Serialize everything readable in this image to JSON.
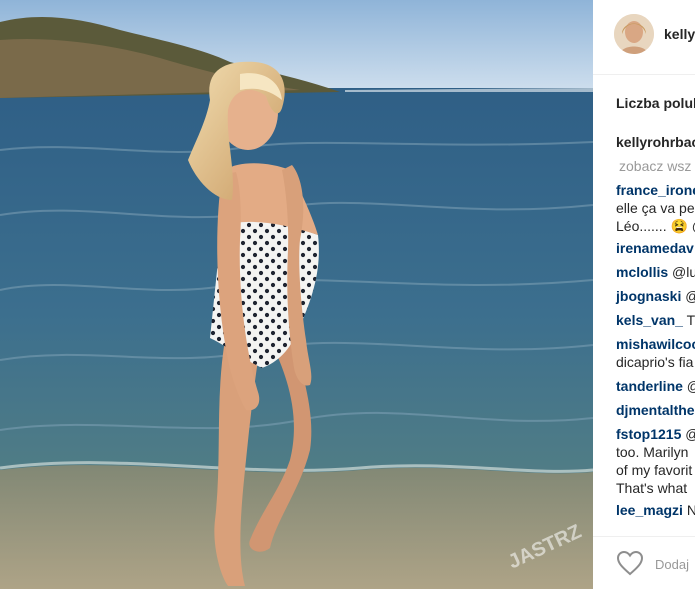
{
  "post": {
    "username": "kelly",
    "likes_label": "Liczba polul"
  },
  "comments": [
    {
      "user": "kellyrohrbac",
      "text": ""
    },
    {
      "more": "zobacz wsz"
    },
    {
      "user": "france_irone",
      "lines": [
        "elle ça va pe",
        "Léo....... 😫 @"
      ]
    },
    {
      "user": "irenamedav",
      "text": ""
    },
    {
      "user": "mclollis",
      "text": "@lu"
    },
    {
      "user": "jbognaski",
      "text": "@"
    },
    {
      "user": "kels_van_",
      "text": "T"
    },
    {
      "user": "mishawilcoc",
      "lines": [
        "dicaprio's fia"
      ]
    },
    {
      "user": "tanderline",
      "text": "@"
    },
    {
      "user": "djmentalthe",
      "text": ""
    },
    {
      "user": "fstop1215",
      "text": "@",
      "lines": [
        "too. Marilyn",
        "of my favorit",
        "That's what"
      ]
    },
    {
      "user": "lee_magzi",
      "text": "N"
    }
  ],
  "footer": {
    "add_comment": "Dodaj",
    "like_icon": "heart-icon"
  },
  "watermark": "JASTRZ"
}
